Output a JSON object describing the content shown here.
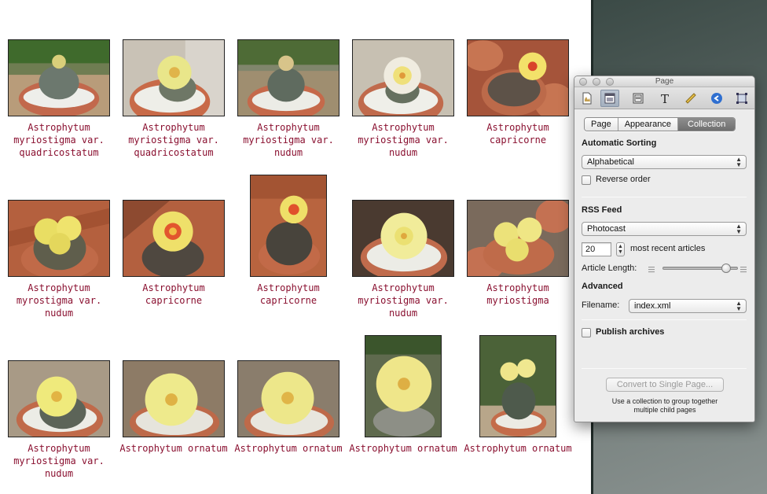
{
  "gallery": {
    "items": [
      {
        "caption": "Astrophytum myriostigma var. quadricostatum"
      },
      {
        "caption": "Astrophytum myriostigma var. quadricostatum"
      },
      {
        "caption": "Astrophytum myriostigma var. nudum"
      },
      {
        "caption": "Astrophytum myriostigma var. nudum"
      },
      {
        "caption": "Astrophytum capricorne"
      },
      {
        "caption": "Astrophytum myrostigma var. nudum"
      },
      {
        "caption": "Astrophytum capricorne"
      },
      {
        "caption": "Astrophytum capricorne"
      },
      {
        "caption": "Astrophytum myriostigma var. nudum"
      },
      {
        "caption": "Astrophytum myriostigma"
      },
      {
        "caption": "Astrophytum myriostigma var. nudum"
      },
      {
        "caption": "Astrophytum ornatum"
      },
      {
        "caption": "Astrophytum ornatum"
      },
      {
        "caption": "Astrophytum ornatum"
      },
      {
        "caption": "Astrophytum ornatum"
      }
    ],
    "caption_color": "#8a1030"
  },
  "inspector": {
    "title": "Page",
    "toolbar_icons": [
      "document-icon",
      "layout-icon",
      "page-frame-icon",
      "text-icon",
      "ruler-icon",
      "link-icon",
      "metrics-icon"
    ],
    "tabs": [
      {
        "label": "Page",
        "selected": false
      },
      {
        "label": "Appearance",
        "selected": false
      },
      {
        "label": "Collection",
        "selected": true
      }
    ],
    "automatic_sorting": {
      "heading": "Automatic Sorting",
      "value": "Alphabetical",
      "reverse_order_label": "Reverse order",
      "reverse_order_checked": false
    },
    "rss": {
      "heading": "RSS Feed",
      "feed_value": "Photocast",
      "count_value": "20",
      "count_suffix": "most recent articles",
      "article_length_label": "Article Length:",
      "article_length_level": 0.84
    },
    "advanced": {
      "heading": "Advanced",
      "filename_label": "Filename:",
      "filename_value": "index.xml",
      "publish_archives_label": "Publish archives",
      "publish_archives_checked": false
    },
    "convert_button_label": "Convert to Single Page...",
    "hint_line1": "Use a collection to group together",
    "hint_line2": "multiple child pages"
  }
}
